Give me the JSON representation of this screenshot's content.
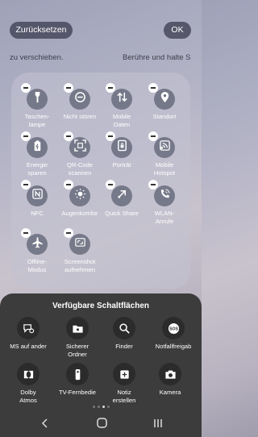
{
  "top": {
    "reset_label": "Zurücksetzen",
    "ok_label": "OK"
  },
  "hints": {
    "left": "zu verschieben.",
    "right": "Berühre und halte S"
  },
  "active_tiles": [
    {
      "label": "Taschen-\nlampe",
      "icon": "flashlight-icon"
    },
    {
      "label": "Nicht stören",
      "icon": "do-not-disturb-icon"
    },
    {
      "label": "Mobile\nDaten",
      "icon": "mobile-data-icon"
    },
    {
      "label": "Standort",
      "icon": "location-icon"
    },
    {
      "label": "Energie\nsparen",
      "icon": "battery-saver-icon"
    },
    {
      "label": "QR-Code\nscannen",
      "icon": "qr-scan-icon"
    },
    {
      "label": "Porträt",
      "icon": "portrait-lock-icon"
    },
    {
      "label": "Mobile\nHotspot",
      "icon": "hotspot-icon"
    },
    {
      "label": "NFC",
      "icon": "nfc-icon"
    },
    {
      "label": "Augenkomfor",
      "icon": "eye-comfort-icon"
    },
    {
      "label": "Quick Share",
      "icon": "quick-share-icon"
    },
    {
      "label": "WLAN-\nAnrufe",
      "icon": "wifi-calling-icon"
    },
    {
      "label": "Offline-\nModus",
      "icon": "airplane-icon"
    },
    {
      "label": "Screenshot\naufnehmen",
      "icon": "screenshot-icon"
    }
  ],
  "sheet": {
    "title": "Verfügbare Schaltflächen",
    "items": [
      {
        "label": "MS auf ander",
        "icon": "sms-forward-icon"
      },
      {
        "label": "Sicherer\nOrdner",
        "icon": "secure-folder-icon"
      },
      {
        "label": "Finder",
        "icon": "search-icon"
      },
      {
        "label": "Notfallfreigab",
        "icon": "sos-icon"
      },
      {
        "label": "Dolby\nAtmos",
        "icon": "dolby-icon"
      },
      {
        "label": "TV-Fernbedie",
        "icon": "tv-remote-icon"
      },
      {
        "label": "Notiz\nerstellen",
        "icon": "create-note-icon"
      },
      {
        "label": "Kamera",
        "icon": "camera-icon"
      }
    ]
  },
  "pager": {
    "pages": 4,
    "active": 2
  }
}
